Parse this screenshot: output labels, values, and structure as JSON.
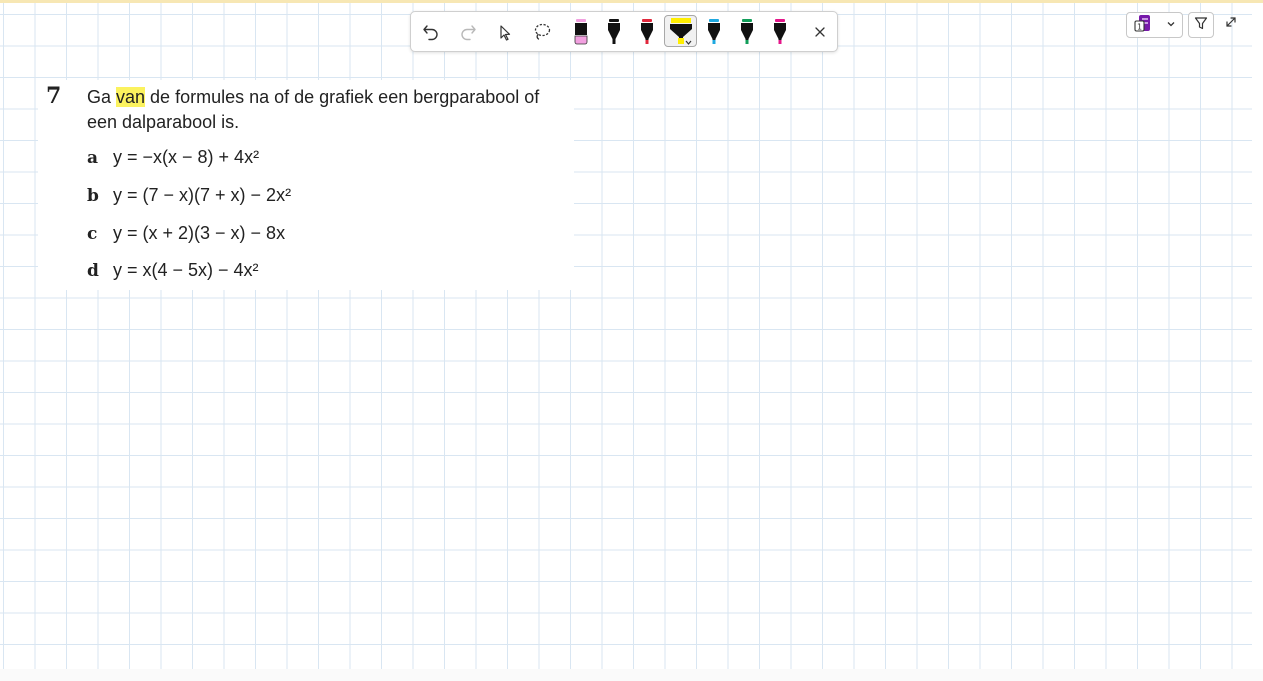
{
  "app": {
    "toolbar": {
      "undo": "undo-icon",
      "redo": "redo-icon",
      "select": "select-pointer-icon",
      "lasso": "lasso-icon",
      "pens": [
        {
          "name": "pen-pink",
          "color": "#f2a0e0"
        },
        {
          "name": "pen-black",
          "color": "#111111"
        },
        {
          "name": "pen-red",
          "color": "#e0283c"
        },
        {
          "name": "highlighter-yellow",
          "color": "#ffee00",
          "selected": true
        },
        {
          "name": "pen-cyan",
          "color": "#1ea8e0"
        },
        {
          "name": "pen-green",
          "color": "#129e5a"
        },
        {
          "name": "pen-magenta",
          "color": "#e4168a"
        }
      ],
      "close": "close-icon"
    },
    "right_controls": {
      "onenote_icon": "onenote-icon",
      "dropdown_icon": "chevron-down-icon",
      "filter_icon": "funnel-icon",
      "expand_icon": "expand-icon"
    }
  },
  "exercise": {
    "number": "7",
    "text_before": "Ga ",
    "highlighted": "van",
    "text_after": " de formules na of de grafiek een bergparabool of een dalparabool is.",
    "parts": [
      {
        "label": "a",
        "formula": "y = −x(x − 8) + 4x²"
      },
      {
        "label": "b",
        "formula": "y = (7 − x)(7 + x) − 2x²"
      },
      {
        "label": "c",
        "formula": "y = (x + 2)(3 − x) − 8x"
      },
      {
        "label": "d",
        "formula": "y = x(4 − 5x) − 4x²"
      }
    ]
  },
  "colors": {
    "grid": "#d9e6f2",
    "highlight": "#fbf25e",
    "accent_top": "#f7e7b4"
  }
}
